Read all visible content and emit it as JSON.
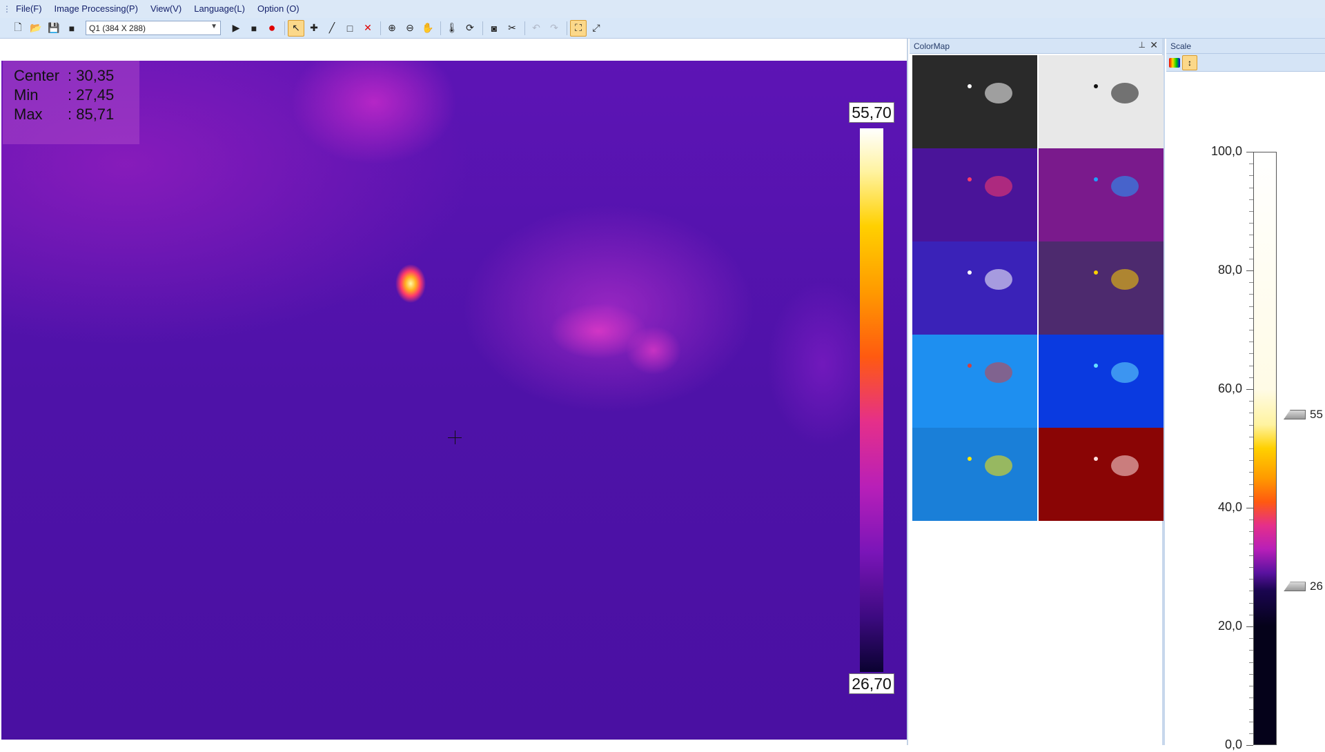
{
  "menu": {
    "items": [
      "File(F)",
      "Image Processing(P)",
      "View(V)",
      "Language(L)",
      "Option (O)"
    ]
  },
  "toolbar": {
    "resolution": "Q1 (384 X 288)"
  },
  "readout": {
    "center_label": "Center",
    "center_value": ": 30,35",
    "min_label": "Min",
    "min_value": ": 27,45",
    "max_label": "Max",
    "max_value": ": 85,71"
  },
  "legend": {
    "max": "55,70",
    "min": "26,70"
  },
  "colormap_panel": {
    "title": "ColorMap",
    "tiles": [
      {
        "bg": "#2a2a2a",
        "hot": "#ffffff"
      },
      {
        "bg": "#e8e8e8",
        "hot": "#111111"
      },
      {
        "bg": "#4a1499",
        "hot": "#ff3a6a"
      },
      {
        "bg": "#7a1a8c",
        "hot": "#1ea0ff"
      },
      {
        "bg": "#3a22b8",
        "hot": "#ffffff"
      },
      {
        "bg": "#4d2a6e",
        "hot": "#ffd000"
      },
      {
        "bg": "#1e8ff0",
        "hot": "#d24040"
      },
      {
        "bg": "#0a3ae0",
        "hot": "#66e0ff"
      },
      {
        "bg": "#1a7fd8",
        "hot": "#ffe800"
      },
      {
        "bg": "#8a0505",
        "hot": "#ffe0e0"
      }
    ]
  },
  "scale_panel": {
    "title": "Scale",
    "ticks": [
      "100,0",
      "80,0",
      "60,0",
      "40,0",
      "20,0",
      "0,0"
    ],
    "marker_high": "55",
    "marker_low": "26"
  }
}
